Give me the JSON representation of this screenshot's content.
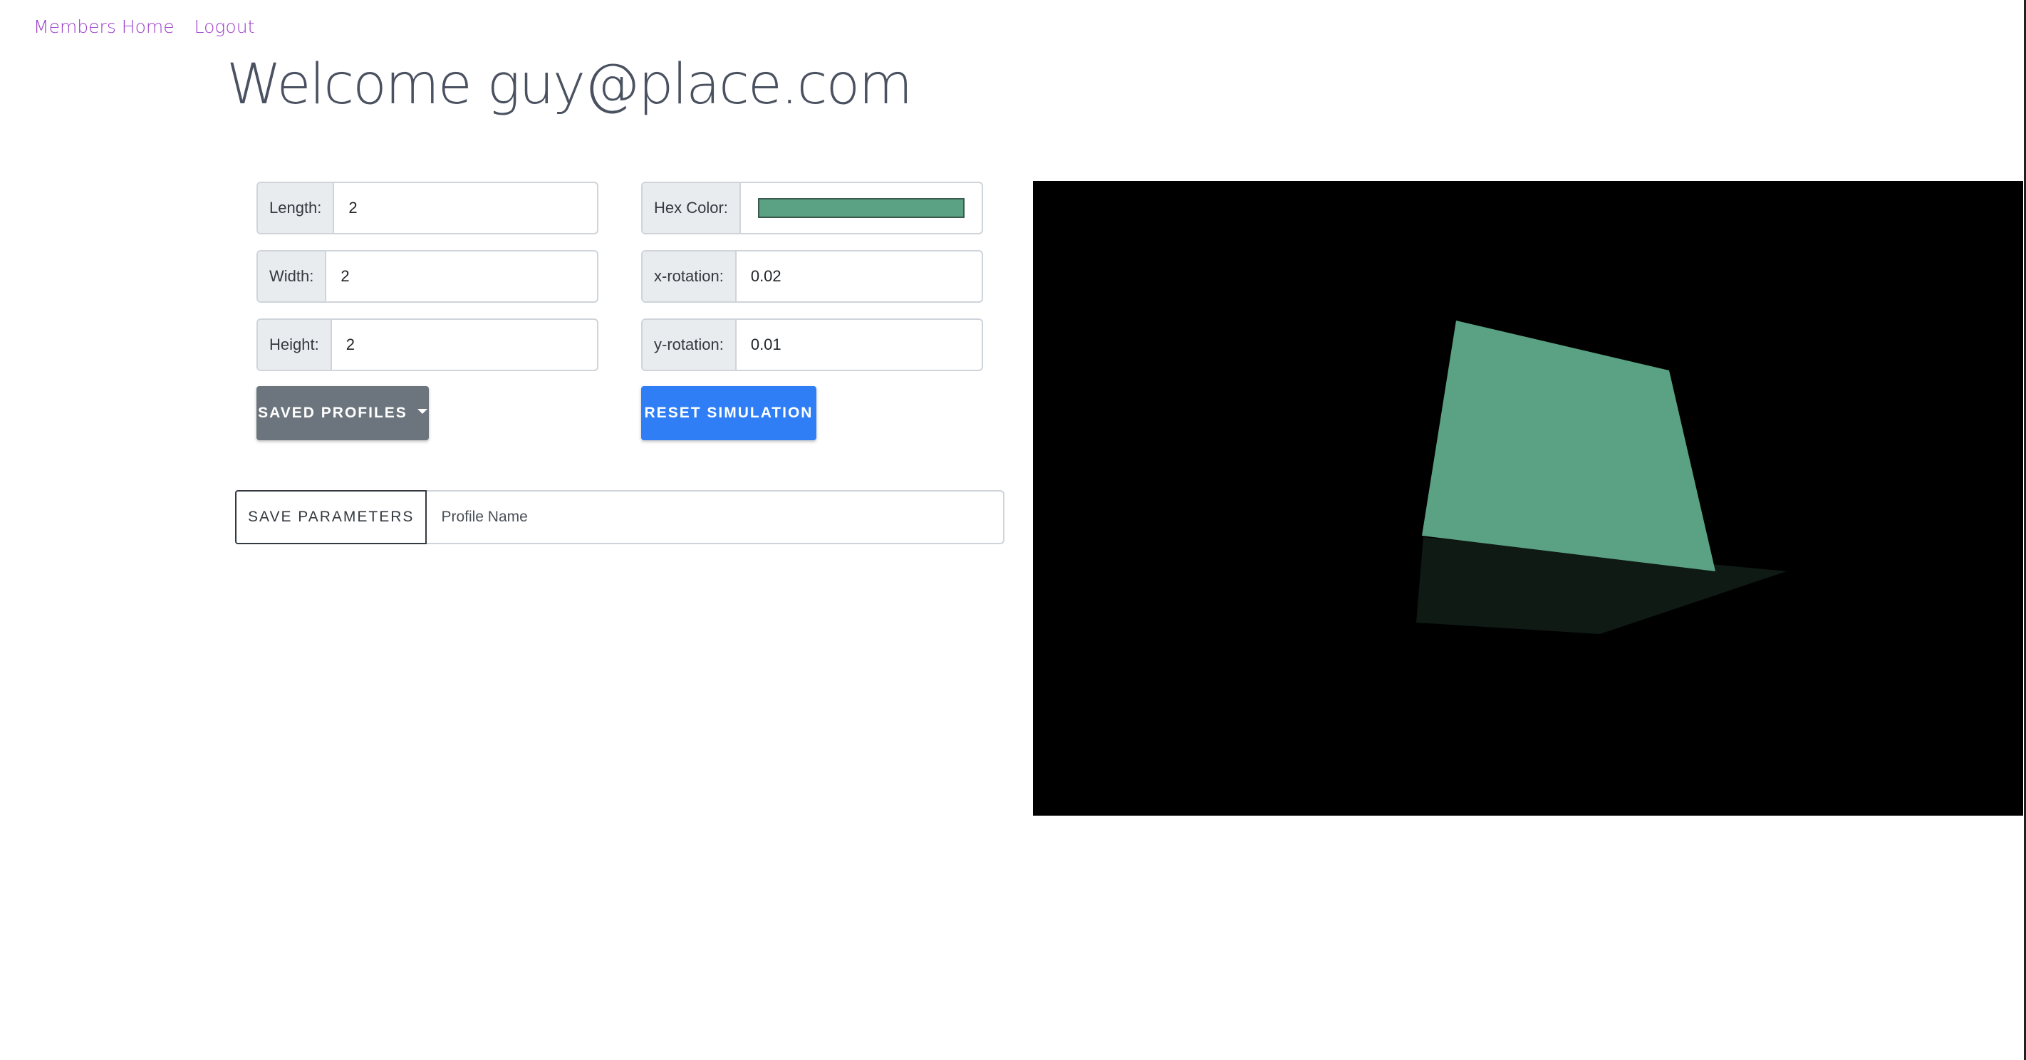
{
  "nav": {
    "members_home": "Members Home",
    "logout": "Logout"
  },
  "page_title": "Welcome guy@place.com",
  "params": {
    "length": {
      "label": "Length:",
      "value": "2"
    },
    "width": {
      "label": "Width:",
      "value": "2"
    },
    "height": {
      "label": "Height:",
      "value": "2"
    },
    "hex_color": {
      "label": "Hex Color:",
      "value": "#5aa283"
    },
    "x_rotation": {
      "label": "x-rotation:",
      "value": "0.02"
    },
    "y_rotation": {
      "label": "y-rotation:",
      "value": "0.01"
    }
  },
  "buttons": {
    "saved_profiles": "SAVED PROFILES",
    "reset_simulation": "RESET SIMULATION",
    "save_parameters": "SAVE PARAMETERS"
  },
  "profile_name": {
    "placeholder": "Profile Name",
    "value": ""
  },
  "colors": {
    "cube_face": "#5aa283",
    "cube_shadow": "#0f1a15",
    "canvas_bg": "#000000",
    "nav_link": "#9b3fc9",
    "primary": "#2f7ef5",
    "secondary": "#6c757d"
  },
  "icons": {
    "dropdown": "caret-down-icon"
  }
}
